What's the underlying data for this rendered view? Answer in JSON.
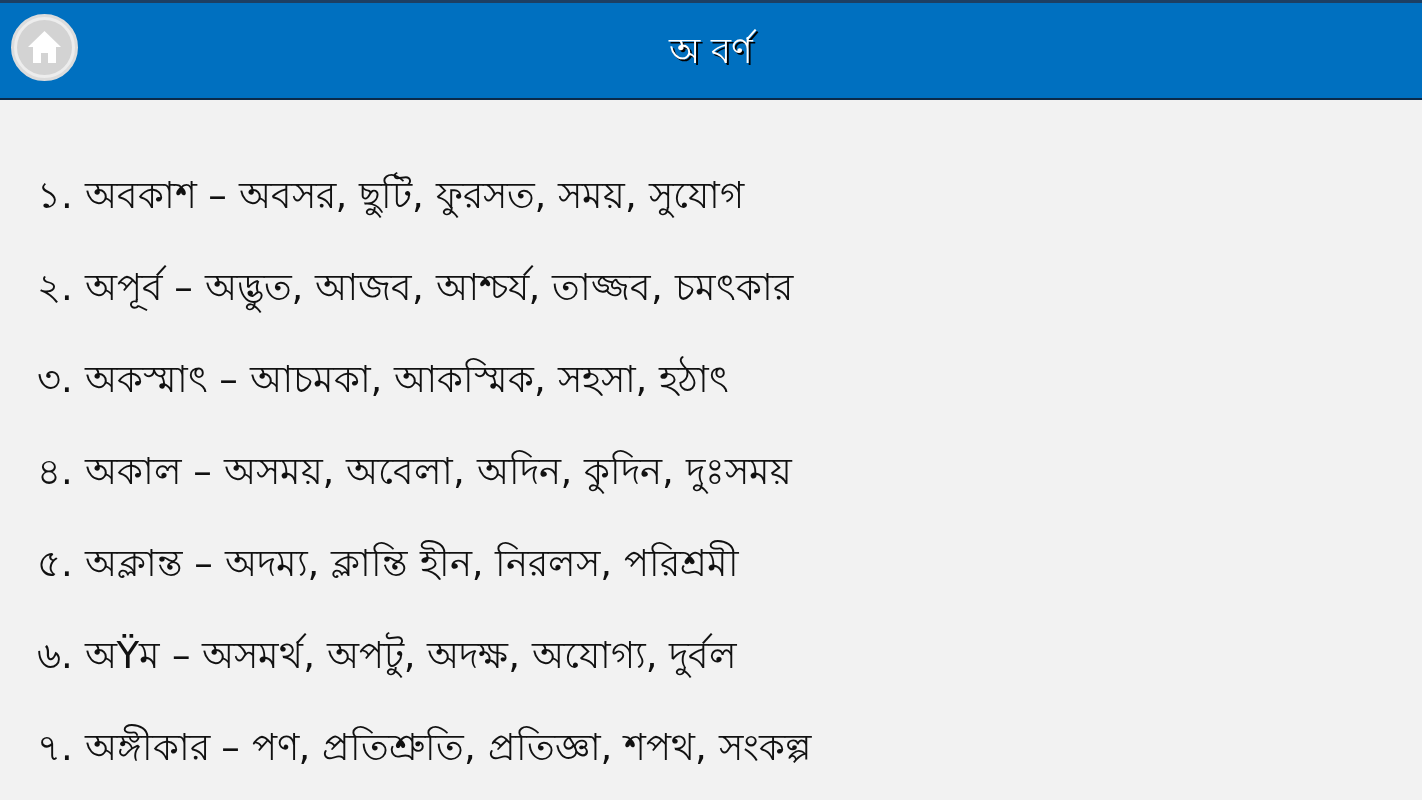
{
  "header": {
    "title": "অ বর্ণ"
  },
  "entries": [
    "১. অবকাশ – অবসর, ছুটি, ফুরসত, সময়, সুযোগ",
    "২. অপূর্ব – অদ্ভুত, আজব, আশ্চর্য, তাজ্জব, চমৎকার",
    "৩. অকস্মাৎ – আচমকা, আকস্মিক, সহসা, হঠাৎ",
    "৪. অকাল – অসময়, অবেলা, অদিন, কুদিন, দুঃসময়",
    "৫. অক্লান্ত – অদম্য, ক্লান্তি হীন, নিরলস, পরিশ্রমী",
    "৬. অŸম – অসমর্থ, অপটু, অদক্ষ, অযোগ্য, দুর্বল",
    "৭. অঙ্গীকার – পণ, প্রতিশ্রুতি, প্রতিজ্ঞা, শপথ, সংকল্প"
  ]
}
